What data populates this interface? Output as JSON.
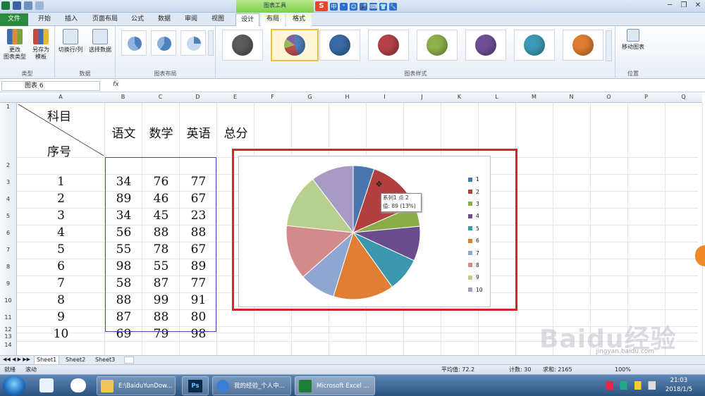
{
  "titlebar": {
    "context_title": "图表工具",
    "sogou": "S",
    "sogou_icons": [
      "中",
      "°",
      "☺",
      "🎤",
      "⌨",
      "👕",
      "🔧"
    ],
    "win_buttons": [
      "─",
      "❐",
      "✕"
    ]
  },
  "tabs": [
    "文件",
    "开始",
    "插入",
    "页面布局",
    "公式",
    "数据",
    "审阅",
    "视图",
    "设计",
    "布局",
    "格式"
  ],
  "ribbon": {
    "change_type": "更改\n图表类型",
    "save_template": "另存为\n模板",
    "group_type": "类型",
    "switch_rowcol": "切换行/列",
    "select_data": "选择数据",
    "group_data": "数据",
    "group_layout": "图表布局",
    "group_styles": "图表样式",
    "move_chart": "移动图表",
    "group_location": "位置",
    "style_colors": [
      "#5a5a5a",
      "#4f81bd",
      "#3a6aa6",
      "#b6404a",
      "#8fb04a",
      "#6e4f96",
      "#3c9ab4",
      "#e07b32"
    ]
  },
  "formula": {
    "namebox": "图表 6",
    "fx": "fx"
  },
  "columns": [
    "A",
    "B",
    "C",
    "D",
    "E",
    "F",
    "G",
    "H",
    "I",
    "J",
    "K",
    "L",
    "M",
    "N",
    "O",
    "P",
    "Q"
  ],
  "rows": [
    "1",
    "2",
    "3",
    "4",
    "5",
    "6",
    "7",
    "8",
    "9",
    "10",
    "11",
    "12",
    "13",
    "14"
  ],
  "table": {
    "header_subject": "科目",
    "header_number": "序号",
    "subjects": [
      "语文",
      "数学",
      "英语",
      "总分"
    ],
    "row_nums": [
      "1",
      "2",
      "3",
      "4",
      "5",
      "6",
      "7",
      "8",
      "9",
      "10"
    ],
    "scores": [
      [
        34,
        76,
        77
      ],
      [
        89,
        46,
        67
      ],
      [
        34,
        45,
        23
      ],
      [
        56,
        88,
        88
      ],
      [
        55,
        78,
        67
      ],
      [
        98,
        55,
        89
      ],
      [
        58,
        87,
        77
      ],
      [
        88,
        99,
        91
      ],
      [
        87,
        88,
        80
      ],
      [
        69,
        79,
        98
      ]
    ]
  },
  "chart_data": {
    "type": "pie",
    "categories": [
      "1",
      "2",
      "3",
      "4",
      "5",
      "6",
      "7",
      "8",
      "9",
      "10"
    ],
    "series": [
      {
        "name": "系列1",
        "values": [
          34,
          89,
          34,
          56,
          55,
          98,
          58,
          88,
          87,
          69
        ]
      }
    ],
    "colors": [
      "#4a76b0",
      "#b23f3f",
      "#8aad4a",
      "#6a4b8c",
      "#3a97ad",
      "#e07f33",
      "#8fa6d2",
      "#d38a8a",
      "#b7d08f",
      "#a79bc6"
    ],
    "legend": "right",
    "tooltip": {
      "line1": "系列1 点 2",
      "line2": "值: 89 (13%)"
    }
  },
  "sheets": [
    "Sheet1",
    "Sheet2",
    "Sheet3"
  ],
  "status": {
    "mode": "就绪",
    "scroll": "滚动",
    "average": "平均值: 72.2",
    "count": "计数: 30",
    "sum": "求和: 2165",
    "zoom": "100%"
  },
  "taskbar": {
    "items": [
      "E:\\BaiduYunDow...",
      "Ps",
      "我的经验_个人中...",
      "Microsoft Excel ..."
    ],
    "time": "21:03",
    "date": "2018/1/5"
  },
  "watermark": {
    "brand": "Baidu经验",
    "url": "jingyan.baidu.com"
  }
}
